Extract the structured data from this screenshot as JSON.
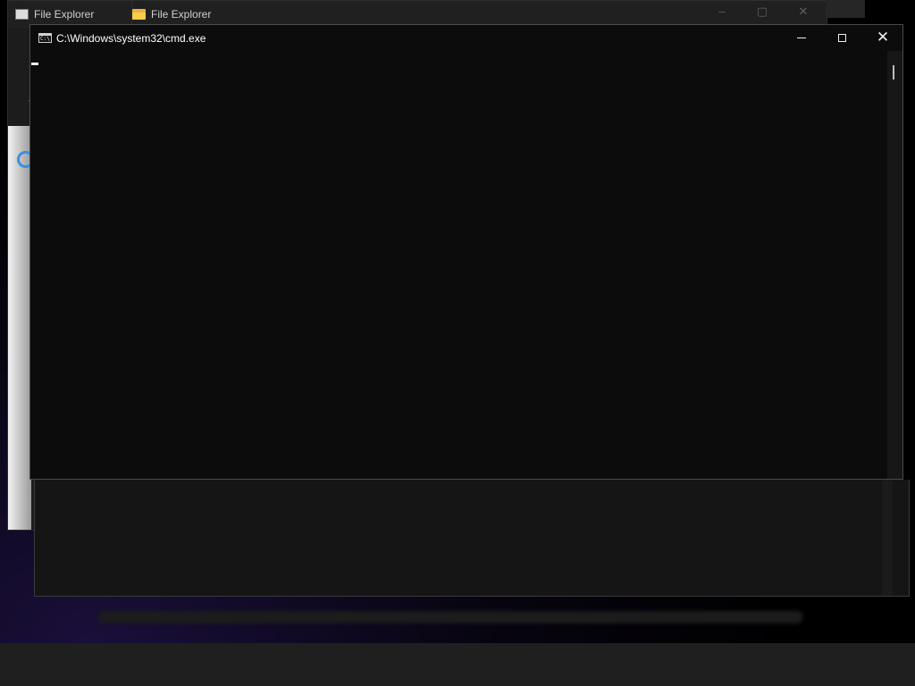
{
  "background_windows": {
    "tabs": [
      {
        "label": "File Explorer",
        "icon": "app-icon"
      },
      {
        "label": "File Explorer",
        "icon": "folder-icon"
      }
    ],
    "buttons": {
      "minimize": "–",
      "maximize": "▢",
      "close": "✕"
    }
  },
  "cmd": {
    "title": "C:\\Windows\\system32\\cmd.exe",
    "icon": "cmd-icon",
    "console_text": "",
    "buttons": {
      "minimize": "minimize",
      "maximize": "maximize",
      "close": "close"
    }
  },
  "colors": {
    "console_bg": "#0c0c0c",
    "accent_ring": "#3b8fe0",
    "taskbar": "#1f1f1f"
  }
}
